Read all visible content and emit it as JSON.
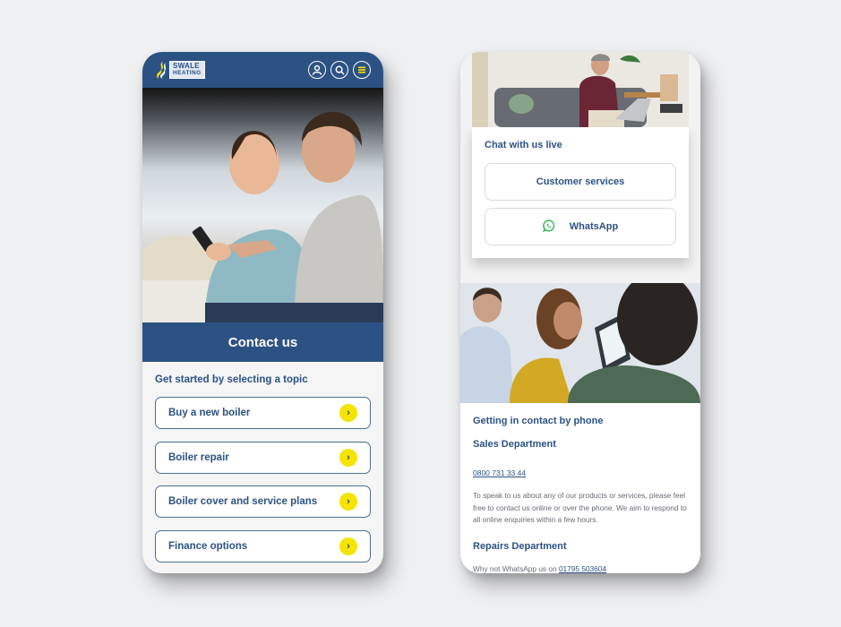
{
  "left_screen": {
    "header": {
      "logo_line1": "SWALE",
      "logo_line2": "HEATING",
      "icons": [
        "account-icon",
        "search-icon",
        "menu-icon"
      ],
      "brand_color": "#2c5283",
      "accent_color": "#f5e400"
    },
    "hero": {
      "image": "couple-looking-at-phone",
      "banner_title": "Contact us"
    },
    "topics": {
      "subtitle": "Get started by selecting a topic",
      "items": [
        {
          "label": "Buy a new boiler",
          "icon": "chevron-right-icon"
        },
        {
          "label": "Boiler repair",
          "icon": "chevron-right-icon"
        },
        {
          "label": "Boiler cover and service plans",
          "icon": "chevron-right-icon"
        },
        {
          "label": "Finance options",
          "icon": "chevron-right-icon"
        }
      ]
    }
  },
  "right_screen": {
    "top_image": "man-on-laptop-in-living-room",
    "chat": {
      "title": "Chat with us live",
      "buttons": [
        {
          "label": "Customer services"
        },
        {
          "label": "WhatsApp",
          "icon": "whatsapp-icon"
        }
      ]
    },
    "middle_image": "call-centre-agent-with-headset",
    "phone_contact": {
      "heading": "Getting in contact by phone",
      "sales": {
        "title": "Sales Department",
        "phone": "0800 731 33 44",
        "description": "To speak to us about any of our products or services, please feel free to contact us online or over the phone. We aim to respond to all online enquiries within a few hours."
      },
      "repairs": {
        "title": "Repairs Department",
        "text_prefix": "Why not WhatsApp us on",
        "phone": "01795 503604"
      }
    }
  }
}
